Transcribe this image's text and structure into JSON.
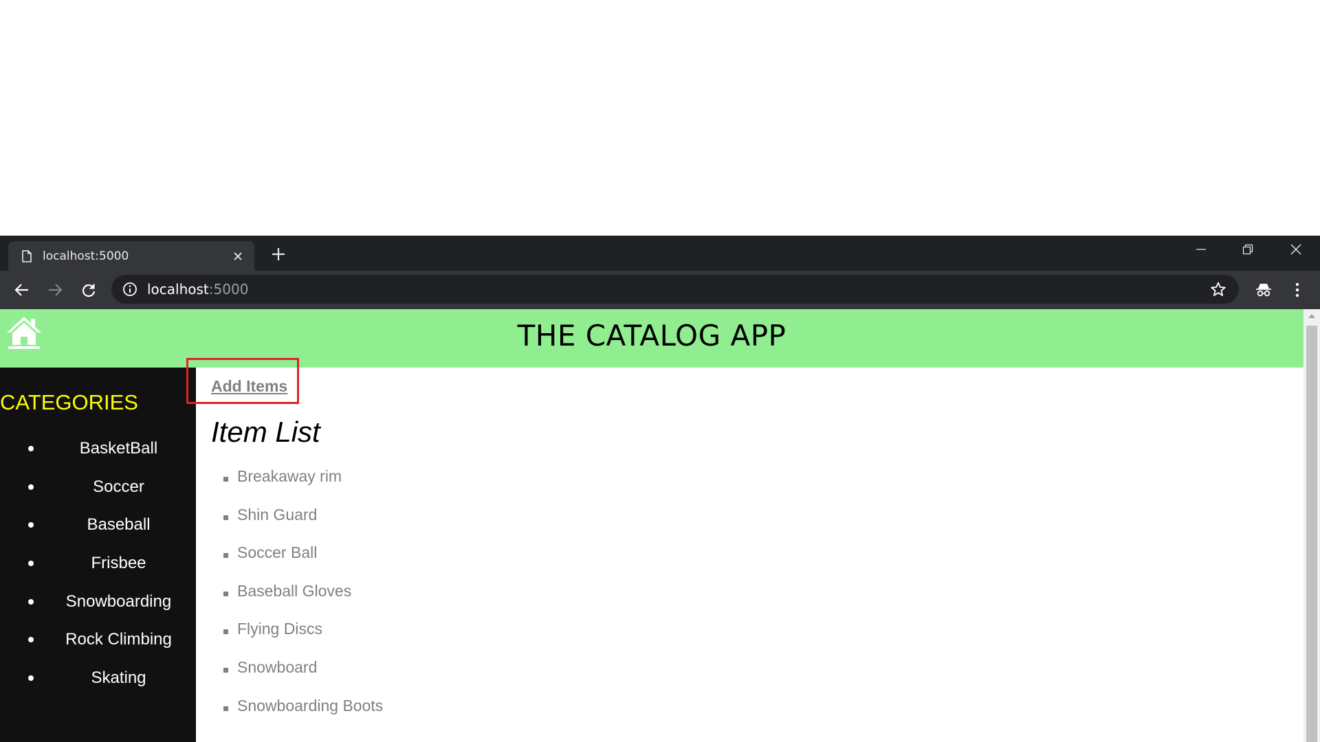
{
  "browser": {
    "tab_title": "localhost:5000",
    "url_host": "localhost",
    "url_port": ":5000"
  },
  "app": {
    "title": "THE CATALOG APP",
    "header_color": "#90ee90"
  },
  "sidebar": {
    "heading": "CATEGORIES",
    "heading_color": "#ffff00",
    "categories": [
      "BasketBall",
      "Soccer",
      "Baseball",
      "Frisbee",
      "Snowboarding",
      "Rock Climbing",
      "Skating"
    ]
  },
  "content": {
    "add_link": "Add Items",
    "heading": "Item List",
    "items": [
      "Breakaway rim",
      "Shin Guard",
      "Soccer Ball",
      "Baseball Gloves",
      "Flying Discs",
      "Snowboard",
      "Snowboarding Boots"
    ],
    "highlight_color": "#e0202a"
  },
  "icons": [
    "page-icon",
    "close-icon",
    "plus-icon",
    "minimize-icon",
    "restore-icon",
    "window-close-icon",
    "back-arrow-icon",
    "forward-arrow-icon",
    "reload-icon",
    "info-icon",
    "star-icon",
    "incognito-icon",
    "kebab-menu-icon",
    "home-icon"
  ]
}
